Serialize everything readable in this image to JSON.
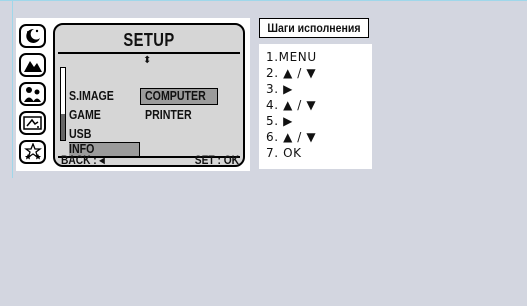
{
  "camera": {
    "mode_icons": [
      "night-scene-icon",
      "landscape-icon",
      "portrait-icon",
      "sport-icon",
      "star-icon"
    ],
    "screen": {
      "title": "SETUP",
      "scroll_arrows": "⬍",
      "menu": {
        "left": [
          "S.IMAGE",
          "GAME",
          "USB",
          "INFO"
        ],
        "right": [
          "COMPUTER",
          "PRINTER"
        ]
      },
      "selected_left": "INFO",
      "selected_right": "COMPUTER",
      "footer_back": "BACK : ◂",
      "footer_set": "SET : OK"
    }
  },
  "steps": {
    "title": "Шаги исполнения",
    "items": [
      "1.MENU",
      "2. ▲ / ▼",
      "3. ▶",
      "4. ▲ / ▼",
      "5. ▶",
      "6. ▲ / ▼",
      "7. OK"
    ]
  }
}
